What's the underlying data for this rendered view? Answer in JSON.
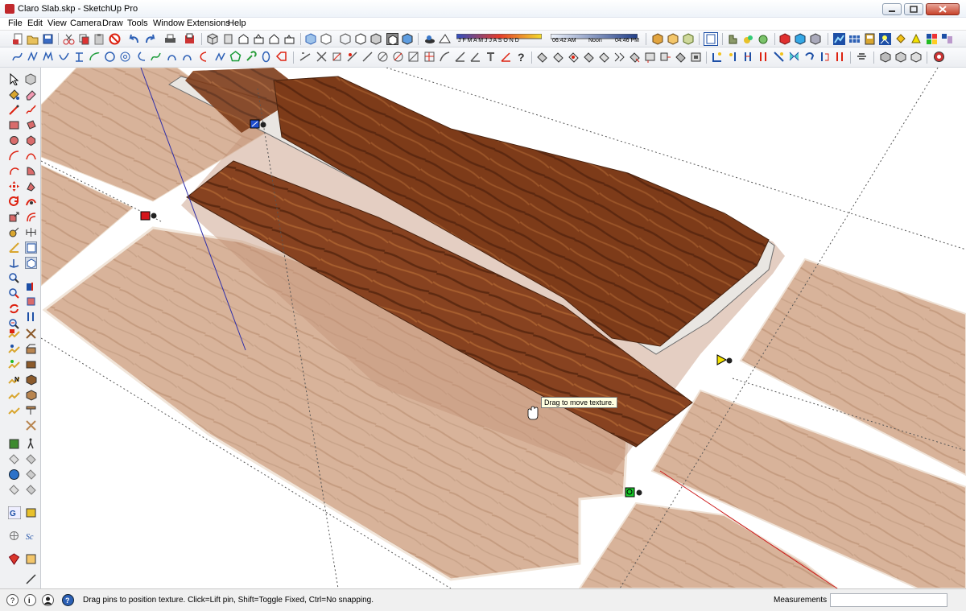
{
  "window": {
    "title": "Claro Slab.skp - SketchUp Pro"
  },
  "menu": [
    "File",
    "Edit",
    "View",
    "Camera",
    "Draw",
    "Tools",
    "Window",
    "Extensions",
    "Help"
  ],
  "shadow_bar": {
    "months": "J F M A M J J A S O N D",
    "time_start": "06:42 AM",
    "time_mid": "Noon",
    "time_end": "04:46 PM"
  },
  "tooltip": "Drag to move texture.",
  "status": {
    "message": "Drag pins to position texture.  Click=Lift pin, Shift=Toggle Fixed, Ctrl=No snapping.",
    "measurements_label": "Measurements",
    "measurements_value": ""
  },
  "colors": {
    "accent_blue": "#1f56b5",
    "pin_red": "#d4161c",
    "pin_blue": "#1f4fcf",
    "pin_yellow": "#f2e100",
    "pin_green": "#18c82a",
    "wood_dark": "#7a3a1b",
    "wood_light": "#d9b59b"
  }
}
